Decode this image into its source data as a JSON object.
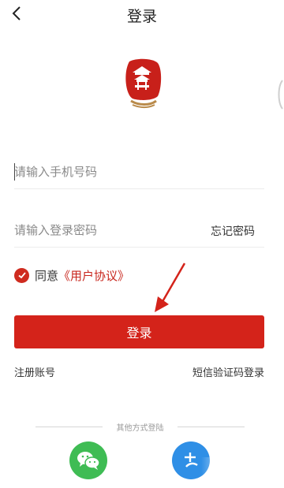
{
  "header": {
    "title": "登录"
  },
  "form": {
    "phone_placeholder": "请输入手机号码",
    "password_placeholder": "请输入登录密码",
    "forgot_label": "忘记密码"
  },
  "agreement": {
    "agree_label": "同意",
    "link_label": "《用户协议》",
    "checked": true
  },
  "actions": {
    "login_label": "登录",
    "register_label": "注册账号",
    "sms_login_label": "短信验证码登录"
  },
  "social": {
    "divider_label": "其他方式登陆",
    "icons": [
      "wechat-icon",
      "other-login-icon"
    ]
  },
  "colors": {
    "brand_red": "#d4231a",
    "wechat_green": "#3fbc54",
    "other_blue": "#2f8fe6"
  }
}
